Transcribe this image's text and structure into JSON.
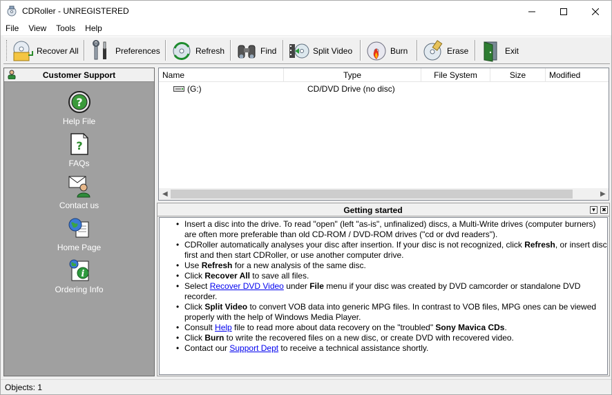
{
  "window": {
    "title": "CDRoller - UNREGISTERED",
    "minimize_icon": "minimize-icon",
    "maximize_icon": "maximize-icon",
    "close_icon": "close-icon"
  },
  "menu": [
    "File",
    "View",
    "Tools",
    "Help"
  ],
  "toolbar": {
    "recover_all": "Recover All",
    "preferences": "Preferences",
    "refresh": "Refresh",
    "find": "Find",
    "split_video": "Split Video",
    "burn": "Burn",
    "erase": "Erase",
    "exit": "Exit"
  },
  "left_panel": {
    "title": "Customer Support",
    "items": [
      {
        "label": "Help File",
        "icon": "help-circle-icon"
      },
      {
        "label": "FAQs",
        "icon": "faq-document-icon"
      },
      {
        "label": "Contact us",
        "icon": "contact-mail-icon"
      },
      {
        "label": "Home Page",
        "icon": "globe-page-icon"
      },
      {
        "label": "Ordering Info",
        "icon": "order-info-icon"
      }
    ]
  },
  "file_list": {
    "columns": [
      "Name",
      "Type",
      "File System",
      "Size",
      "Modified"
    ],
    "rows": [
      {
        "name": "(G:)",
        "type": "CD/DVD Drive (no disc)",
        "file_system": "",
        "size": "",
        "modified": ""
      }
    ]
  },
  "getting_started": {
    "title": "Getting started",
    "items": [
      {
        "parts": [
          {
            "t": "Insert a disc into the drive. To read \"open\" (left \"as-is\", unfinalized) discs, a Multi-Write drives (computer burners) are often more preferable than old CD-ROM / DVD-ROM drives (\"cd or dvd readers\")."
          }
        ]
      },
      {
        "parts": [
          {
            "t": "CDRoller automatically analyses your disc after insertion. If your disc is not recognized, click "
          },
          {
            "t": "Refresh",
            "b": true
          },
          {
            "t": ", or insert disc first and then start CDRoller, or use another computer drive."
          }
        ]
      },
      {
        "parts": [
          {
            "t": "Use "
          },
          {
            "t": "Refresh",
            "b": true
          },
          {
            "t": " for a new analysis of the same disc."
          }
        ]
      },
      {
        "parts": [
          {
            "t": "Click "
          },
          {
            "t": "Recover All",
            "b": true
          },
          {
            "t": " to save all files."
          }
        ]
      },
      {
        "parts": [
          {
            "t": "Select "
          },
          {
            "t": "Recover DVD Video",
            "a": true
          },
          {
            "t": " under "
          },
          {
            "t": "File",
            "b": true
          },
          {
            "t": " menu if your disc was created by DVD camcorder or standalone DVD recorder."
          }
        ]
      },
      {
        "parts": [
          {
            "t": "Click "
          },
          {
            "t": "Split Video",
            "b": true
          },
          {
            "t": " to convert VOB data into generic MPG files. In contrast to VOB files, MPG ones can be viewed properly with the help of Windows Media Player."
          }
        ]
      },
      {
        "parts": [
          {
            "t": "Consult "
          },
          {
            "t": "Help",
            "a": true
          },
          {
            "t": " file to read more about data recovery on the \"troubled\" "
          },
          {
            "t": "Sony Mavica CDs",
            "b": true
          },
          {
            "t": "."
          }
        ]
      },
      {
        "parts": [
          {
            "t": "Click "
          },
          {
            "t": "Burn",
            "b": true
          },
          {
            "t": " to write the recovered files on a new disc, or create DVD with recovered video."
          }
        ]
      },
      {
        "parts": [
          {
            "t": "Contact our "
          },
          {
            "t": "Support Dept",
            "a": true
          },
          {
            "t": " to receive a technical assistance shortly."
          }
        ]
      }
    ]
  },
  "status": {
    "text": "Objects: 1"
  },
  "colors": {
    "accent_link": "#0000ee",
    "panel_gray": "#a0a0a0"
  }
}
